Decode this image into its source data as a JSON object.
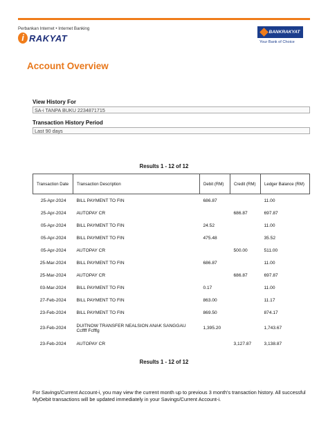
{
  "header": {
    "tagline": "Perbankan Internet • Internet Banking",
    "logo_i": "i",
    "logo_text": "RAKYAT",
    "bank_name": "BANKRAKYAT",
    "bank_tagline": "Your Bank of Choice",
    "accent_color": "#f07c1a",
    "brand_color": "#1b3d8c"
  },
  "page": {
    "title": "Account Overview",
    "history_label": "View History For",
    "history_value": "SA-i TANPA BUKU 2234871715",
    "period_label": "Transaction History Period",
    "period_value": "Last 90 days",
    "results_top": "Results 1 - 12 of 12",
    "results_bottom": "Results 1 - 12 of 12",
    "note": "For Savings/Current Account-i, you may view the current month up to previous 3 month's transaction history. All successful MyDebit transactions will be updated immediately in your Savings/Current Account-i."
  },
  "table": {
    "columns": {
      "date": "Transaction Date",
      "desc": "Transaction Description",
      "debit": "Debit (RM)",
      "credit": "Credit (RM)",
      "balance": "Ledger Balance (RM)"
    },
    "rows": [
      {
        "date": "25-Apr-2024",
        "desc": "BILL PAYMENT TO FIN",
        "debit": "686.87",
        "credit": "",
        "balance": "11.00"
      },
      {
        "date": "25-Apr-2024",
        "desc": "AUTOPAY CR",
        "debit": "",
        "credit": "686.87",
        "balance": "697.87"
      },
      {
        "date": "05-Apr-2024",
        "desc": "BILL PAYMENT TO FIN",
        "debit": "24.52",
        "credit": "",
        "balance": "11.00"
      },
      {
        "date": "05-Apr-2024",
        "desc": "BILL PAYMENT TO FIN",
        "debit": "475.48",
        "credit": "",
        "balance": "35.52"
      },
      {
        "date": "05-Apr-2024",
        "desc": "AUTOPAY CR",
        "debit": "",
        "credit": "500.00",
        "balance": "511.00"
      },
      {
        "date": "25-Mar-2024",
        "desc": "BILL PAYMENT TO FIN",
        "debit": "686.87",
        "credit": "",
        "balance": "11.00"
      },
      {
        "date": "25-Mar-2024",
        "desc": "AUTOPAY CR",
        "debit": "",
        "credit": "686.87",
        "balance": "697.87"
      },
      {
        "date": "03-Mar-2024",
        "desc": "BILL PAYMENT TO FIN",
        "debit": "0.17",
        "credit": "",
        "balance": "11.00"
      },
      {
        "date": "27-Feb-2024",
        "desc": "BILL PAYMENT TO FIN",
        "debit": "863.00",
        "credit": "",
        "balance": "11.17"
      },
      {
        "date": "23-Feb-2024",
        "desc": "BILL PAYMENT TO FIN",
        "debit": "869.50",
        "credit": "",
        "balance": "874.17"
      },
      {
        "date": "23-Feb-2024",
        "desc": "DUITNOW TRANSFER NEALSION ANAK SANGGAU Ccffff Fcfffg",
        "debit": "1,395.20",
        "credit": "",
        "balance": "1,743.67"
      },
      {
        "date": "23-Feb-2024",
        "desc": "AUTOPAY CR",
        "debit": "",
        "credit": "3,127.87",
        "balance": "3,138.87"
      }
    ]
  }
}
